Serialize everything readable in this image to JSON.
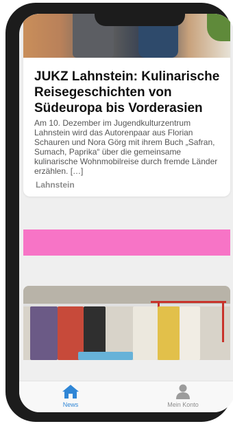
{
  "article": {
    "title": "JUKZ Lahnstein: Kulinarische Reisegeschichten von Südeuropa bis Vorderasien",
    "excerpt": "Am 10. Dezember im Jugendkulturzentrum Lahnstein wird das Autorenpaar aus Florian Schauren und Nora Görg mit ihrem Buch „Safran, Sumach, Paprika“ über die gemeinsame kulinarische Wohnmobilreise durch fremde Länder erzählen. […]",
    "tag": "Lahnstein"
  },
  "ad": {
    "color": "#f774c6"
  },
  "tabbar": {
    "items": [
      {
        "label": "News",
        "icon": "home-icon",
        "active": true,
        "color": "#2f86d6"
      },
      {
        "label": "Mein Konto",
        "icon": "person-icon",
        "active": false,
        "color": "#8e8e8e"
      }
    ]
  }
}
